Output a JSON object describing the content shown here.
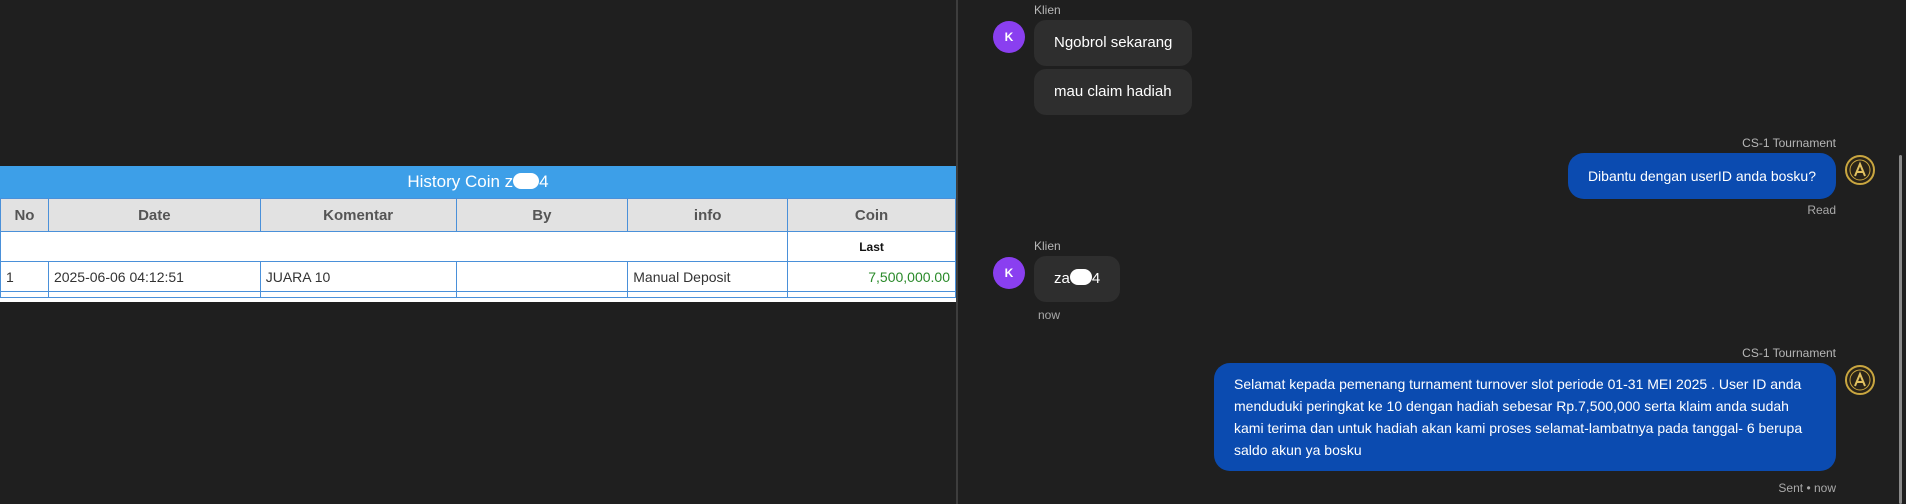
{
  "history": {
    "title_prefix": "History Coin z",
    "title_suffix": "4",
    "columns": [
      "No",
      "Date",
      "Komentar",
      "By",
      "info",
      "Coin"
    ],
    "subheader_coin": "Last",
    "rows": [
      {
        "no": "1",
        "date": "2025-06-06 04:12:51",
        "komentar": "JUARA 10",
        "by": "",
        "info": "Manual Deposit",
        "coin": "7,500,000.00"
      }
    ]
  },
  "chat": {
    "client_label": "Klien",
    "client_avatar": "K",
    "agent_label": "CS-1 Tournament",
    "messages": {
      "in1": "Ngobrol sekarang",
      "in2": "mau claim hadiah",
      "out1": "Dibantu dengan userID anda bosku?",
      "out1_status": "Read",
      "in3_prefix": "za",
      "in3_suffix": "4",
      "in3_time": "now",
      "out2": "Selamat kepada pemenang turnament turnover slot periode 01-31 MEI 2025 . User ID anda menduduki peringkat ke 10 dengan hadiah sebesar Rp.7,500,000 serta klaim anda sudah kami terima dan untuk hadiah akan kami proses selamat-lambatnya pada tanggal- 6 berupa saldo akun ya bosku",
      "out2_status": "Sent • now"
    }
  },
  "colors": {
    "header_blue": "#3d9fe8",
    "bubble_out": "#0b4bb0",
    "avatar_purple": "#8a3ff0",
    "coin_green": "#2a8a2a"
  },
  "icons": {
    "agent_avatar": "gold-emblem-icon"
  }
}
